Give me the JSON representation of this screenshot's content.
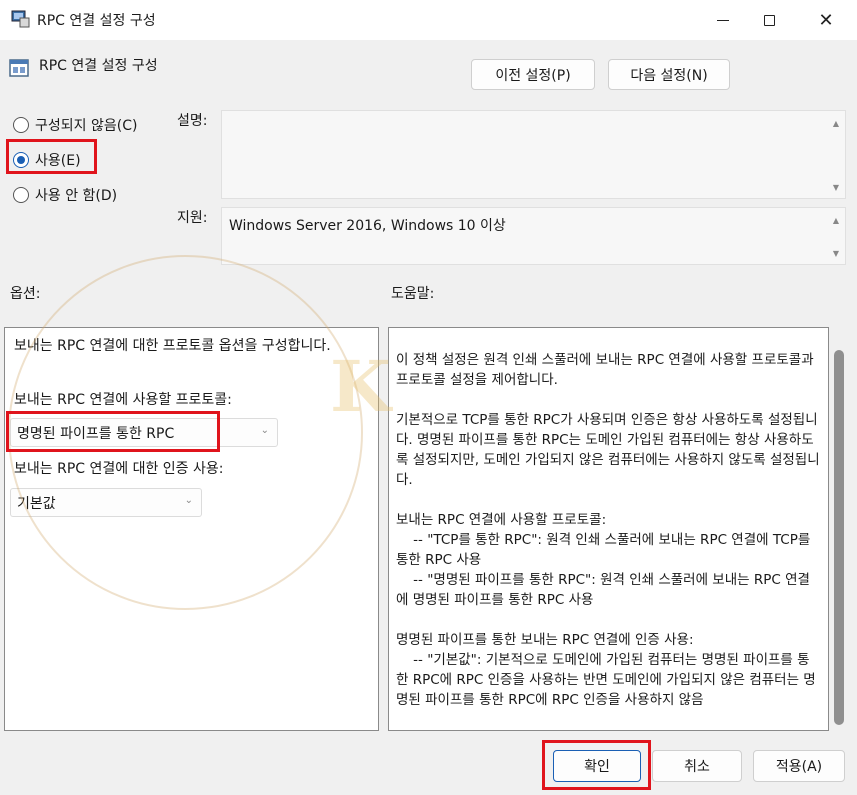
{
  "window": {
    "title": "RPC 연결 설정 구성",
    "minimize_icon": "minimize-icon",
    "maximize_icon": "maximize-icon",
    "close_icon": "close-icon"
  },
  "header": {
    "title": "RPC 연결 설정 구성",
    "prev_button": "이전 설정(P)",
    "next_button": "다음 설정(N)"
  },
  "state": {
    "options": [
      {
        "label": "구성되지 않음(C)",
        "selected": false
      },
      {
        "label": "사용(E)",
        "selected": true
      },
      {
        "label": "사용 안 함(D)",
        "selected": false
      }
    ]
  },
  "info": {
    "comment_label": "설명:",
    "comment_value": "",
    "supported_label": "지원:",
    "supported_value": "Windows Server 2016, Windows 10 이상"
  },
  "options_panel": {
    "heading": "옵션:",
    "description": "보내는 RPC 연결에 대한 프로토콜 옵션을 구성합니다.",
    "protocol_label": "보내는 RPC 연결에 사용할 프로토콜:",
    "protocol_value": "명명된 파이프를 통한 RPC",
    "auth_label": "보내는 RPC 연결에 대한 인증 사용:",
    "auth_value": "기본값"
  },
  "help_panel": {
    "heading": "도움말:",
    "text": "이 정책 설정은 원격 인쇄 스풀러에 보내는 RPC 연결에 사용할 프로토콜과 프로토콜 설정을 제어합니다.\n\n기본적으로 TCP를 통한 RPC가 사용되며 인증은 항상 사용하도록 설정됩니다. 명명된 파이프를 통한 RPC는 도메인 가입된 컴퓨터에는 항상 사용하도록 설정되지만, 도메인 가입되지 않은 컴퓨터에는 사용하지 않도록 설정됩니다.\n\n보내는 RPC 연결에 사용할 프로토콜:\n    -- \"TCP를 통한 RPC\": 원격 인쇄 스풀러에 보내는 RPC 연결에 TCP를 통한 RPC 사용\n    -- \"명명된 파이프를 통한 RPC\": 원격 인쇄 스풀러에 보내는 RPC 연결에 명명된 파이프를 통한 RPC 사용\n\n명명된 파이프를 통한 보내는 RPC 연결에 인증 사용:\n    -- \"기본값\": 기본적으로 도메인에 가입된 컴퓨터는 명명된 파이프를 통한 RPC에 RPC 인증을 사용하는 반면 도메인에 가입되지 않은 컴퓨터는 명명된 파이프를 통한 RPC에 RPC 인증을 사용하지 않음"
  },
  "footer": {
    "ok_button": "확인",
    "cancel_button": "취소",
    "apply_button": "적용(A)"
  },
  "colors": {
    "highlight": "#e0141c",
    "radio_selected": "#1a5fb4"
  }
}
